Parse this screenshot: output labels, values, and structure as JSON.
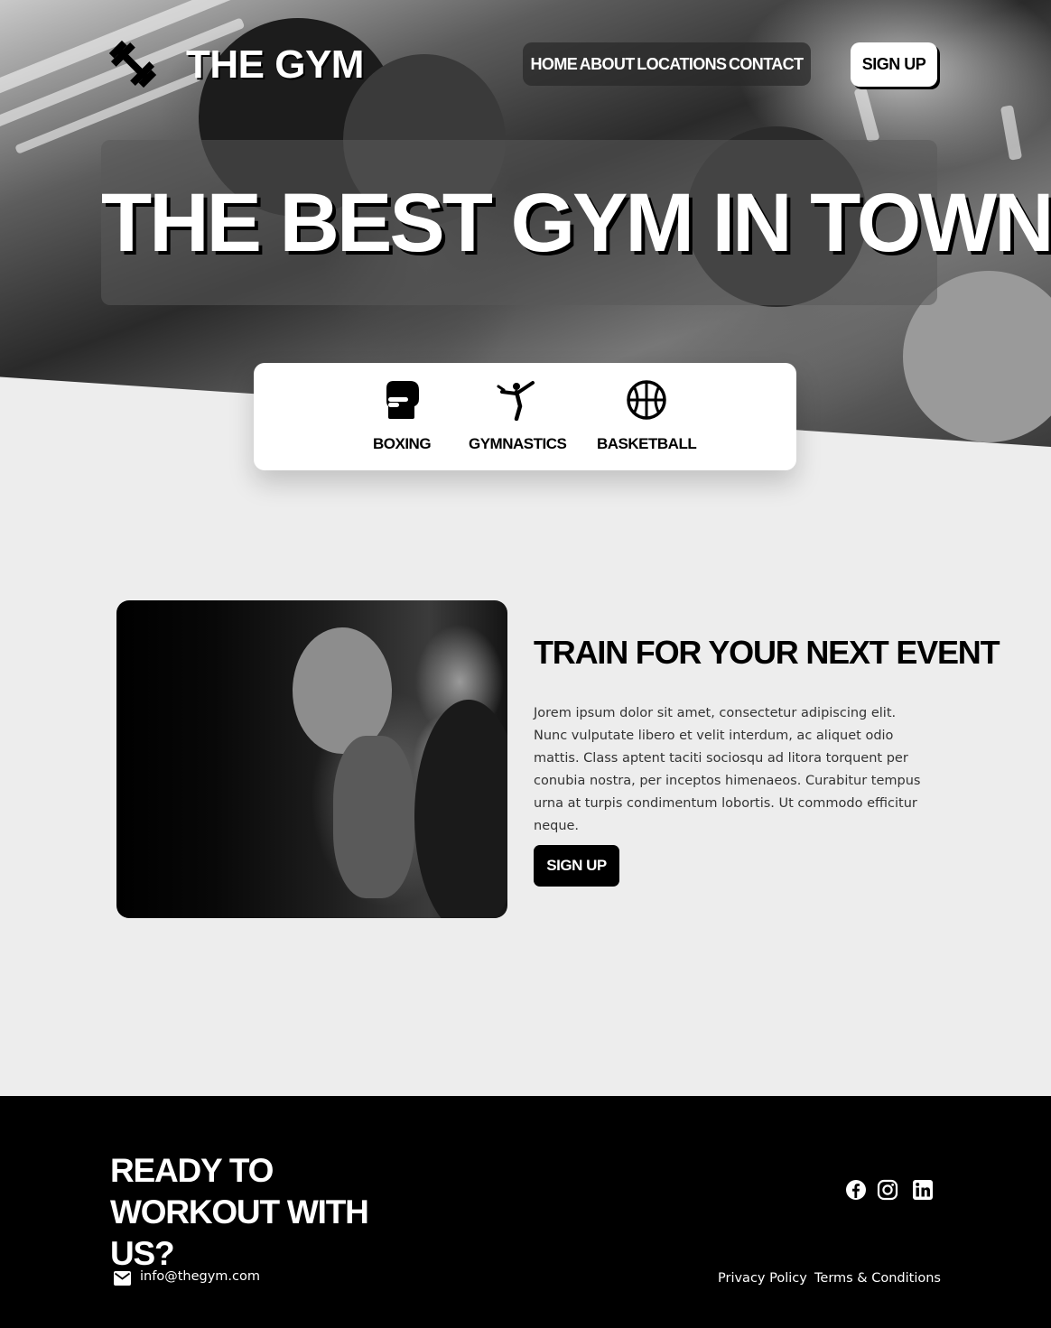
{
  "brand": {
    "name": "THE GYM",
    "logo_icon": "dumbbell-icon"
  },
  "nav": {
    "links": [
      "HOME",
      "ABOUT",
      "LOCATIONS",
      "CONTACT"
    ],
    "signup_label": "SIGN UP"
  },
  "hero": {
    "headline": "THE BEST GYM IN TOWN"
  },
  "categories": [
    {
      "label": "BOXING",
      "icon": "boxing-glove-icon"
    },
    {
      "label": "GYMNASTICS",
      "icon": "gymnast-kick-icon"
    },
    {
      "label": "BASKETBALL",
      "icon": "basketball-icon"
    }
  ],
  "feature": {
    "title": "TRAIN FOR YOUR NEXT EVENT",
    "body": "Jorem ipsum dolor sit amet, consectetur adipiscing elit. Nunc vulputate libero et velit interdum, ac aliquet odio mattis. Class aptent taciti sociosqu ad litora torquent per conubia nostra, per inceptos himenaeos. Curabitur tempus urna at turpis condimentum lobortis. Ut commodo efficitur neque.",
    "button_label": "SIGN UP"
  },
  "footer": {
    "title": "READY TO WORKOUT WITH US?",
    "email": "info@thegym.com",
    "links": [
      "Privacy Policy",
      "Terms & Conditions"
    ],
    "social_icons": [
      "facebook-icon",
      "instagram-icon",
      "linkedin-icon"
    ]
  },
  "colors": {
    "background": "#ededed",
    "primary": "#000000",
    "text_light": "#ffffff"
  }
}
